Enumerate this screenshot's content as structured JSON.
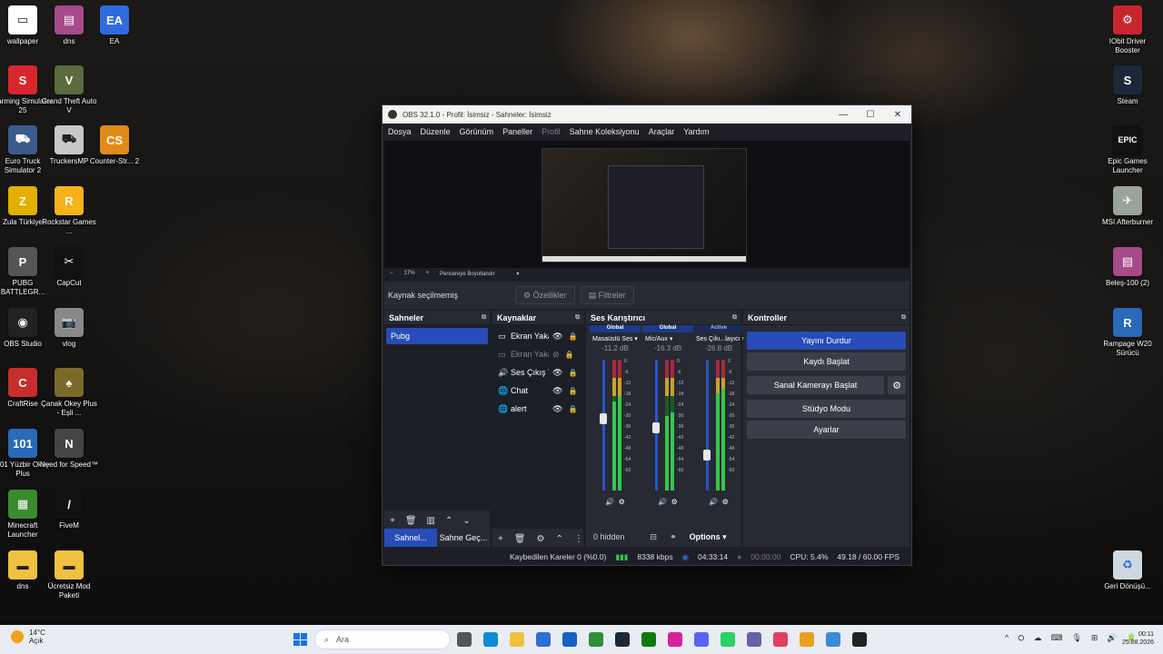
{
  "desktop": {
    "icons_left": [
      {
        "label": "wallpaper",
        "color": "#ffffff",
        "glyph": "▭"
      },
      {
        "label": "dns",
        "color": "#a64a8a",
        "glyph": "▤"
      },
      {
        "label": "EA",
        "color": "#2e6bde",
        "glyph": "EA"
      },
      {
        "label": "Farming Simulator 25",
        "color": "#d8262e",
        "glyph": "S"
      },
      {
        "label": "Grand Theft Auto V",
        "color": "#5b6b3a",
        "glyph": "V"
      },
      {
        "label": "Euro Truck Simulator 2",
        "color": "#3a5a8a",
        "glyph": "⛟"
      },
      {
        "label": "TruckersMP",
        "color": "#c8c8c8",
        "glyph": "⛟"
      },
      {
        "label": "Counter-Str... 2",
        "color": "#e28a17",
        "glyph": "CS"
      },
      {
        "label": "Zula Türkiye",
        "color": "#e1b000",
        "glyph": "Z"
      },
      {
        "label": "Rockstar Games ...",
        "color": "#f5b21c",
        "glyph": "R"
      },
      {
        "label": "PUBG BATTLEGR...",
        "color": "#555",
        "glyph": "P"
      },
      {
        "label": "CapCut",
        "color": "#111111",
        "glyph": "✂"
      },
      {
        "label": "OBS Studio",
        "color": "#222222",
        "glyph": "◉"
      },
      {
        "label": "vlog",
        "color": "#888888",
        "glyph": "📷"
      },
      {
        "label": "CraftRise",
        "color": "#c82d2d",
        "glyph": "C"
      },
      {
        "label": "Çanak Okey Plus - Eşli ...",
        "color": "#7a6a2a",
        "glyph": "♠"
      },
      {
        "label": "101 Yüzbir Okey Plus",
        "color": "#2a6ab8",
        "glyph": "101"
      },
      {
        "label": "Need for Speed™",
        "color": "#444444",
        "glyph": "N"
      },
      {
        "label": "Minecraft Launcher",
        "color": "#3c8a2e",
        "glyph": "▦"
      },
      {
        "label": "FiveM",
        "color": "#111111",
        "glyph": "/"
      },
      {
        "label": "dns",
        "color": "#f0c040",
        "glyph": "▬"
      },
      {
        "label": "Ücretsiz Mod Paketi",
        "color": "#f0c040",
        "glyph": "▬"
      }
    ],
    "icons_right": [
      {
        "label": "IObit Driver Booster",
        "color": "#c8262e",
        "glyph": "⚙"
      },
      {
        "label": "Steam",
        "color": "#1b2838",
        "glyph": "S"
      },
      {
        "label": "Epic Games Launcher",
        "color": "#111111",
        "glyph": "EPIC"
      },
      {
        "label": "MSI Afterburner",
        "color": "#9aa39a",
        "glyph": "✈"
      },
      {
        "label": "Beleş-100 (2)",
        "color": "#a64a8a",
        "glyph": "▤"
      },
      {
        "label": "Rampage W20 Sürücü",
        "color": "#2a6ab8",
        "glyph": "R"
      },
      {
        "label": "Geri Dönüşü...",
        "color": "#cfd8e0",
        "glyph": "♻"
      }
    ]
  },
  "obs": {
    "title": "OBS 32.1.0 - Profil: İsimsiz - Sahneler: İsimsiz",
    "menu": [
      "Dosya",
      "Düzenle",
      "Görünüm",
      "Paneller",
      "Profil",
      "Sahne Koleksiyonu",
      "Araçlar",
      "Yardım"
    ],
    "zoom": {
      "minus": "−",
      "value": "17%",
      "plus": "+",
      "fit": "Pencereye Boyutlandır"
    },
    "no_source": "Kaynak seçilmemiş",
    "properties_btn": "Özellikler",
    "filters_btn": "Filtreler",
    "scenes": {
      "title": "Sahneler",
      "items": [
        "Pubg"
      ],
      "tab_active": "Sahnel...",
      "tab_other": "Sahne Geç..."
    },
    "sources": {
      "title": "Kaynaklar",
      "items": [
        {
          "name": "Ekran Yaka",
          "icon": "▭",
          "dim": false,
          "visible": true
        },
        {
          "name": "Ekran Yaka",
          "icon": "▭",
          "dim": true,
          "visible": false
        },
        {
          "name": "Ses Çıkış Y",
          "icon": "🔊",
          "dim": false,
          "visible": true
        },
        {
          "name": "Chat",
          "icon": "🌐",
          "dim": false,
          "visible": true
        },
        {
          "name": "alert",
          "icon": "🌐",
          "dim": false,
          "visible": true
        }
      ]
    },
    "mixer": {
      "title": "Ses Karıştırıcı",
      "channels": [
        {
          "scope": "Global",
          "name": "Masaüstü Ses",
          "db": "-11.2 dB",
          "level": 0.72,
          "slider": 0.55
        },
        {
          "scope": "Global",
          "name": "Mic/Aux",
          "db": "-16.3 dB",
          "level": 0.6,
          "slider": 0.48
        },
        {
          "scope": "Active",
          "name": "Ses Çıkı...layıcı",
          "db": "-26.8 dB",
          "level": 0.78,
          "slider": 0.27
        }
      ],
      "ticks": [
        "0",
        "-6",
        "-12",
        "-18",
        "-24",
        "-30",
        "-36",
        "-42",
        "-48",
        "-54",
        "-60"
      ],
      "hidden": "0 hidden",
      "options": "Options"
    },
    "controls": {
      "title": "Kontroller",
      "stream": "Yayını Durdur",
      "record": "Kaydı Başlat",
      "vcam": "Sanal Kamerayı Başlat",
      "studio": "Stüdyo Modu",
      "settings": "Ayarlar"
    },
    "status": {
      "dropped": "Kaybedilen Kareler 0 (%0.0)",
      "bitrate": "8338 kbps",
      "stream_time": "04:33:14",
      "rec_time": "00:00:00",
      "cpu": "CPU: 5.4%",
      "fps": "49.18 / 60.00 FPS"
    }
  },
  "taskbar": {
    "weather_temp": "14°C",
    "weather_desc": "Açık",
    "search_placeholder": "Ara",
    "time": "00:11",
    "date": "25.08.2026",
    "apps": [
      {
        "name": "file-explorer",
        "color": "#555555"
      },
      {
        "name": "edge",
        "color": "#0f8bd8"
      },
      {
        "name": "folder",
        "color": "#f0c040"
      },
      {
        "name": "store",
        "color": "#2f6fd1"
      },
      {
        "name": "outlook",
        "color": "#1662c2"
      },
      {
        "name": "gamepass",
        "color": "#2d8f3c"
      },
      {
        "name": "steam",
        "color": "#1b2838"
      },
      {
        "name": "xbox",
        "color": "#0f7b0f"
      },
      {
        "name": "instagram",
        "color": "#d6249f"
      },
      {
        "name": "discord",
        "color": "#5865f2"
      },
      {
        "name": "whatsapp",
        "color": "#25d366"
      },
      {
        "name": "teams",
        "color": "#6264a7"
      },
      {
        "name": "photos",
        "color": "#e04060"
      },
      {
        "name": "chrome",
        "color": "#e8a020"
      },
      {
        "name": "app-blue",
        "color": "#3a8ad8"
      },
      {
        "name": "obs",
        "color": "#222222"
      }
    ],
    "tray": [
      "^",
      "⛭",
      "☁",
      "⌨",
      "🎙",
      "⊞",
      "🔊",
      "🔋"
    ]
  }
}
